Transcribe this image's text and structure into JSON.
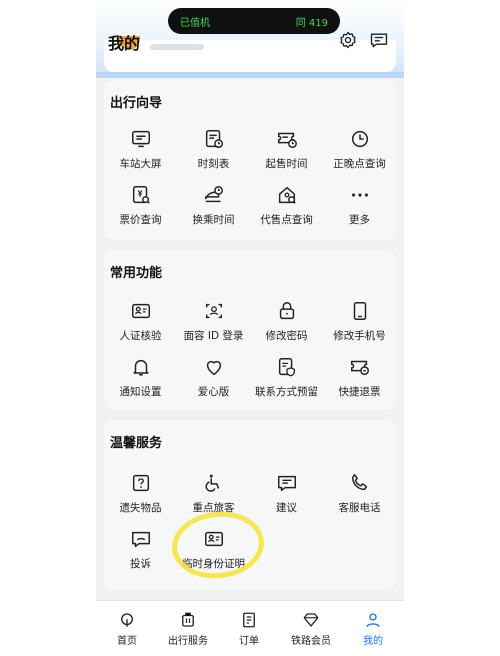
{
  "status_bar": {
    "left": "已值机",
    "right": "同 419"
  },
  "header": {
    "title": "我的"
  },
  "sections": {
    "guide": {
      "title": "出行向导",
      "items": [
        {
          "label": "车站大屏",
          "icon": "screen-icon"
        },
        {
          "label": "时刻表",
          "icon": "timetable-icon"
        },
        {
          "label": "起售时间",
          "icon": "ticket-clock-icon"
        },
        {
          "label": "正晚点查询",
          "icon": "clock-icon"
        },
        {
          "label": "票价查询",
          "icon": "price-search-icon"
        },
        {
          "label": "换乘时间",
          "icon": "transfer-icon"
        },
        {
          "label": "代售点查询",
          "icon": "agency-search-icon"
        },
        {
          "label": "更多",
          "icon": "more-icon"
        }
      ]
    },
    "common": {
      "title": "常用功能",
      "items": [
        {
          "label": "人证核验",
          "icon": "id-card-icon"
        },
        {
          "label": "面容 ID 登录",
          "icon": "face-id-icon"
        },
        {
          "label": "修改密码",
          "icon": "lock-icon"
        },
        {
          "label": "修改手机号",
          "icon": "phone-icon"
        },
        {
          "label": "通知设置",
          "icon": "bell-icon"
        },
        {
          "label": "爱心版",
          "icon": "heart-icon"
        },
        {
          "label": "联系方式预留",
          "icon": "contact-shield-icon"
        },
        {
          "label": "快捷退票",
          "icon": "refund-icon"
        }
      ]
    },
    "service": {
      "title": "温馨服务",
      "items": [
        {
          "label": "遗失物品",
          "icon": "lost-item-icon"
        },
        {
          "label": "重点旅客",
          "icon": "wheelchair-icon"
        },
        {
          "label": "建议",
          "icon": "suggestion-icon"
        },
        {
          "label": "客服电话",
          "icon": "phone-call-icon"
        },
        {
          "label": "投诉",
          "icon": "complaint-icon"
        },
        {
          "label": "临时身份证明",
          "icon": "temp-id-icon"
        }
      ]
    }
  },
  "tabbar": {
    "items": [
      {
        "label": "首页",
        "icon": "home-icon"
      },
      {
        "label": "出行服务",
        "icon": "luggage-icon"
      },
      {
        "label": "订单",
        "icon": "order-icon"
      },
      {
        "label": "铁路会员",
        "icon": "diamond-icon"
      },
      {
        "label": "我的",
        "icon": "person-icon"
      }
    ],
    "active_index": 4
  },
  "colors": {
    "accent": "#1677ff",
    "highlight": "#f7e33a",
    "island_text": "#3ddc5c"
  }
}
